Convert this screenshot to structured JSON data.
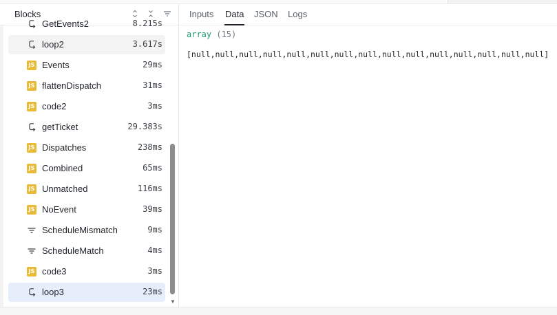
{
  "blocks_panel": {
    "title": "Blocks",
    "items": [
      {
        "name": "GetEvents2",
        "time": "8.215s",
        "icon": "loop-icon"
      },
      {
        "name": "loop2",
        "time": "3.617s",
        "icon": "loop-icon"
      },
      {
        "name": "Events",
        "time": "29ms",
        "icon": "js-icon"
      },
      {
        "name": "flattenDispatch",
        "time": "31ms",
        "icon": "js-icon"
      },
      {
        "name": "code2",
        "time": "3ms",
        "icon": "js-icon"
      },
      {
        "name": "getTicket",
        "time": "29.383s",
        "icon": "loop-icon"
      },
      {
        "name": "Dispatches",
        "time": "238ms",
        "icon": "js-icon"
      },
      {
        "name": "Combined",
        "time": "65ms",
        "icon": "js-icon"
      },
      {
        "name": "Unmatched",
        "time": "116ms",
        "icon": "js-icon"
      },
      {
        "name": "NoEvent",
        "time": "39ms",
        "icon": "js-icon"
      },
      {
        "name": "ScheduleMismatch",
        "time": "9ms",
        "icon": "filter-icon"
      },
      {
        "name": "ScheduleMatch",
        "time": "4ms",
        "icon": "filter-icon"
      },
      {
        "name": "code3",
        "time": "3ms",
        "icon": "js-icon"
      },
      {
        "name": "loop3",
        "time": "23ms",
        "icon": "loop-icon"
      }
    ],
    "js_label": "JS"
  },
  "detail_panel": {
    "tabs": [
      "Inputs",
      "Data",
      "JSON",
      "Logs"
    ],
    "active_tab": "Data",
    "data_type": "array",
    "data_length": "(15)",
    "data_value": "[null,null,null,null,null,null,null,null,null,null,null,null,null,null,null]"
  },
  "colors": {
    "js_badge": "#e8ba38",
    "array_type": "#1a9c6b",
    "selected_row": "#e6eefb",
    "hover_row": "#f3f3f3"
  }
}
